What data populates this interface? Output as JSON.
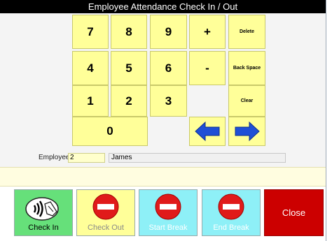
{
  "window": {
    "title": "Employee Attendance Check In / Out"
  },
  "keypad": {
    "k7": "7",
    "k8": "8",
    "k9": "9",
    "plus": "+",
    "delete": "Delete",
    "k4": "4",
    "k5": "5",
    "k6": "6",
    "minus": "-",
    "backspace": "Back Space",
    "k1": "1",
    "k2": "2",
    "k3": "3",
    "clear": "Clear",
    "k0": "0"
  },
  "employee": {
    "label": "Employee:",
    "id": "2",
    "name": "James"
  },
  "actions": {
    "check_in": "Check In",
    "check_out": "Check Out",
    "start_break": "Start Break",
    "end_break": "End Break",
    "close": "Close"
  },
  "colors": {
    "key": "#ffff99",
    "arrow": "#1f4fd6",
    "check_in": "#66e07a",
    "break": "#8ef0f7",
    "close": "#cc0000",
    "no_entry": "#e01a1a"
  },
  "icons": {
    "check_in": "contactless-card-icon",
    "check_out": "no-entry-icon",
    "start_break": "no-entry-icon",
    "end_break": "no-entry-icon",
    "left": "arrow-left-icon",
    "right": "arrow-right-icon"
  }
}
